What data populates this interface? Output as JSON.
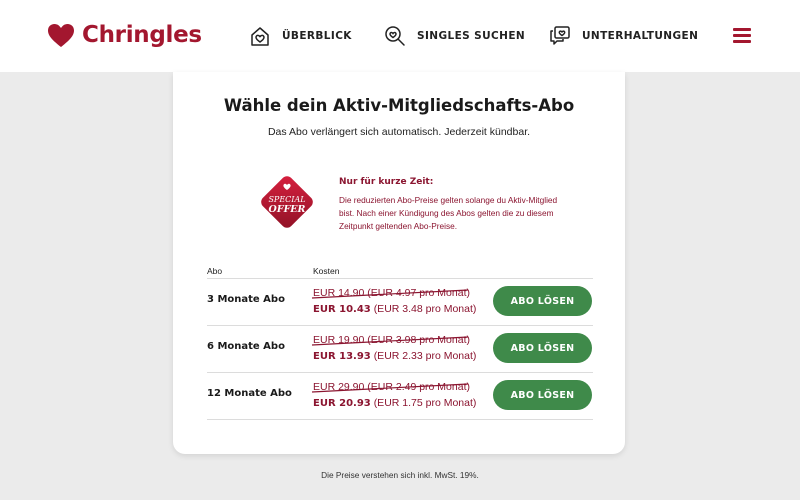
{
  "brand": {
    "name": "Chringles",
    "color": "#a3172f"
  },
  "nav": [
    {
      "label": "ÜBERBLICK",
      "icon": "home-heart-icon"
    },
    {
      "label": "SINGLES SUCHEN",
      "icon": "search-heart-icon"
    },
    {
      "label": "UNTERHALTUNGEN",
      "icon": "chat-heart-icon"
    }
  ],
  "menu": {
    "icon": "hamburger-menu-icon"
  },
  "card": {
    "title": "Wähle dein Aktiv-Mitgliedschafts-Abo",
    "subtitle": "Das Abo verlängert sich automatisch. Jederzeit kündbar."
  },
  "offer": {
    "badge_line1": "SPECIAL",
    "badge_line2": "OFFER",
    "title": "Nur für kurze Zeit:",
    "text": "Die reduzierten Abo-Preise gelten solange du Aktiv-Mitglied bist. Nach einer Kündigung des Abos gelten die zu diesem Zeitpunkt geltenden Abo-Preise."
  },
  "table": {
    "col_plan": "Abo",
    "col_cost": "Kosten",
    "rows": [
      {
        "plan": "3 Monate Abo",
        "old_price": "EUR 14.90 (EUR 4.97 pro Monat)",
        "new_total": "EUR 10.43",
        "new_monthly": "(EUR 3.48 pro Monat)",
        "button": "ABO LÖSEN"
      },
      {
        "plan": "6 Monate Abo",
        "old_price": "EUR 19.90 (EUR 3.98 pro Monat)",
        "new_total": "EUR 13.93",
        "new_monthly": "(EUR 2.33 pro Monat)",
        "button": "ABO LÖSEN"
      },
      {
        "plan": "12 Monate Abo",
        "old_price": "EUR 29.90 (EUR 2.49 pro Monat)",
        "new_total": "EUR 20.93",
        "new_monthly": "(EUR 1.75 pro Monat)",
        "button": "ABO LÖSEN"
      }
    ]
  },
  "footer": {
    "note": "Die Preise verstehen sich inkl. MwSt. 19%."
  },
  "colors": {
    "accent": "#a3172f",
    "price": "#8b1530",
    "button": "#3f8a4a",
    "background": "#ebebeb"
  }
}
